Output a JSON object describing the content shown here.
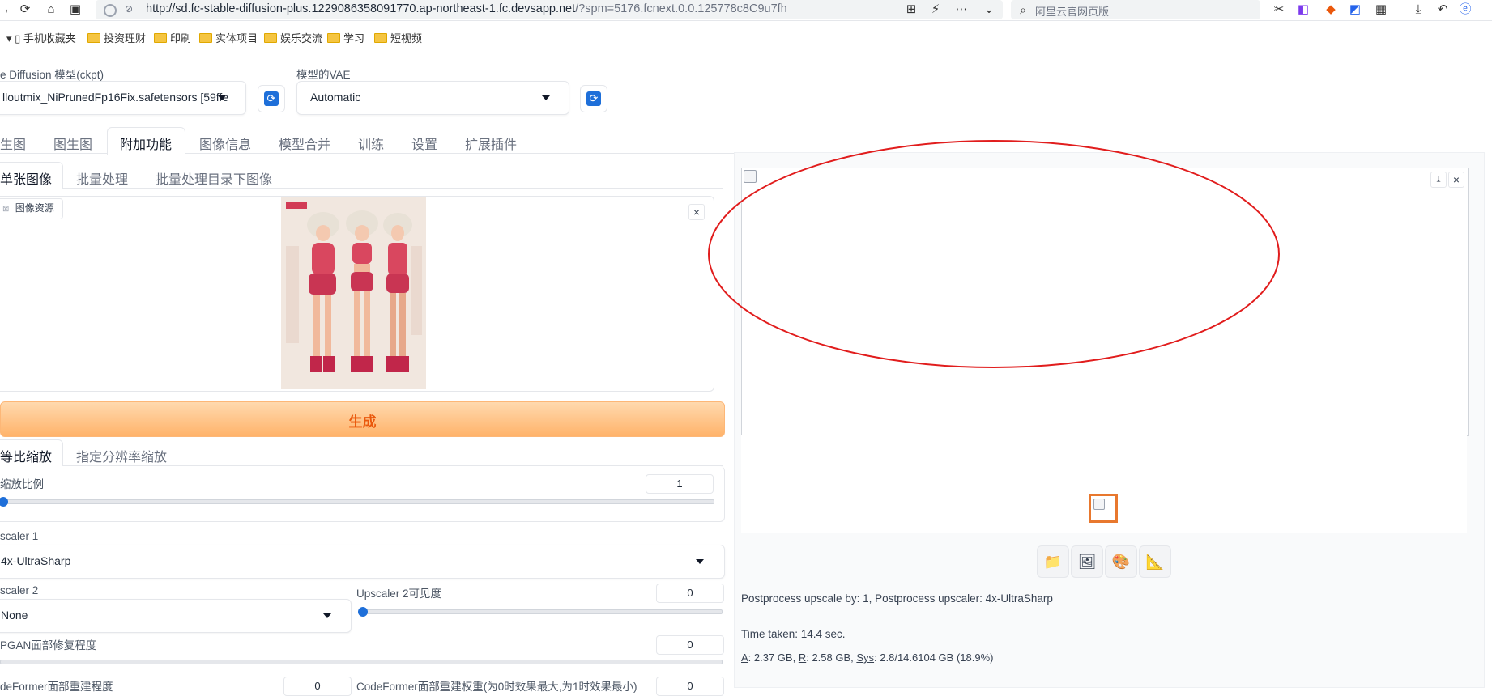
{
  "browser": {
    "url_main": "http://sd.fc-stable-diffusion-plus.1229086358091770.ap-northeast-1.fc.devsapp.net",
    "url_query": "/?spm=5176.fcnext.0.0.125778c8C9u7fh",
    "search_text": "阿里云官网页版",
    "bookmarks": [
      "手机收藏夹",
      "投资理财",
      "印刷",
      "实体项目",
      "娱乐交流",
      "学习",
      "短视频"
    ]
  },
  "model": {
    "ckpt_label": "e Diffusion 模型(ckpt)",
    "ckpt_value": "lloutmix_NiPrunedFp16Fix.safetensors [59ffe",
    "vae_label": "模型的VAE",
    "vae_value": "Automatic"
  },
  "main_tabs": [
    "生图",
    "图生图",
    "附加功能",
    "图像信息",
    "模型合并",
    "训练",
    "设置",
    "扩展插件"
  ],
  "sub_tabs": [
    "单张图像",
    "批量处理",
    "批量处理目录下图像"
  ],
  "image_source_label": "图像资源",
  "close_glyph": "×",
  "generate_label": "生成",
  "scale_tabs": [
    "等比缩放",
    "指定分辨率缩放"
  ],
  "scale": {
    "label": "缩放比例",
    "value": "1",
    "fraction": 0.0
  },
  "upscaler1": {
    "label": "scaler 1",
    "value": "4x-UltraSharp"
  },
  "upscaler2": {
    "label": "scaler 2",
    "value": "None"
  },
  "upscaler2_visibility": {
    "label": "Upscaler 2可见度",
    "value": "0",
    "fraction": 0.0
  },
  "gfpgan": {
    "label": "PGAN面部修复程度",
    "value": "0"
  },
  "codeformer": {
    "label": "deFormer面部重建程度",
    "label2": "CodeFormer面部重建权重(为0时效果最大,为1时效果最小)",
    "value": "0"
  },
  "output": {
    "info_line1": "Postprocess upscale by: 1, Postprocess upscaler: 4x-UltraSharp",
    "time_taken": "Time taken: 14.4 sec.",
    "mem_a": "A",
    "mem_a_val": ": 2.37 GB, ",
    "mem_r": "R",
    "mem_r_val": ": 2.58 GB, ",
    "mem_sys": "Sys",
    "mem_sys_val": ": 2.8/14.6104 GB (18.9%)"
  },
  "colors": {
    "annotation_red": "#e11d1d",
    "thumb_orange": "#e8782e",
    "accent_blue": "#1e6fd9",
    "generate_orange": "#ea580c"
  },
  "icons": [
    "folder-icon",
    "image-icon",
    "palette-icon",
    "ruler-icon"
  ]
}
